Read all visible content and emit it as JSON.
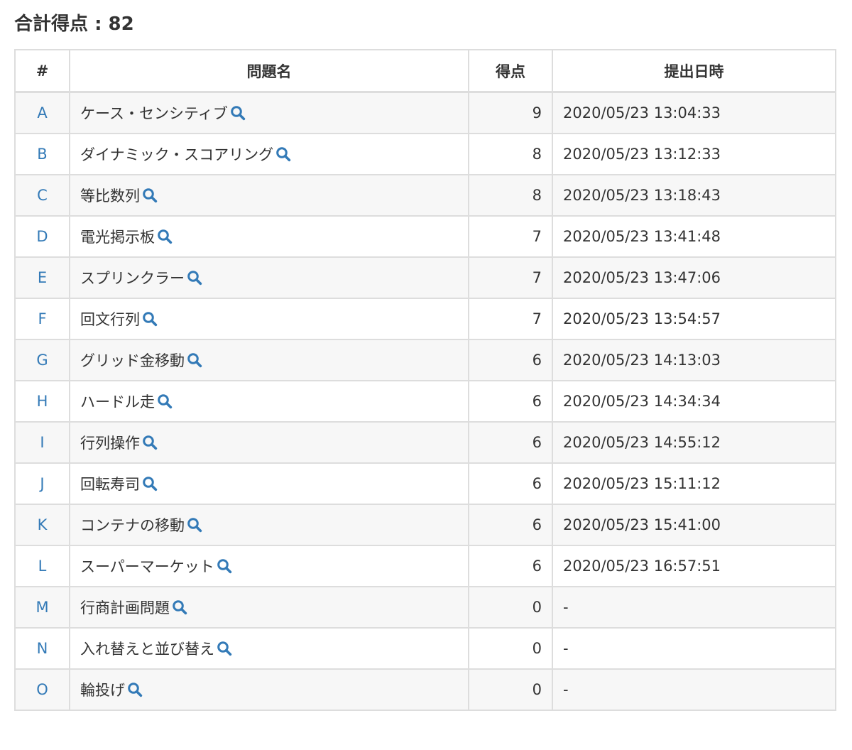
{
  "total": {
    "label": "合計得点",
    "separator": " : ",
    "value": "82"
  },
  "table": {
    "headers": [
      "#",
      "問題名",
      "得点",
      "提出日時"
    ],
    "rows": [
      {
        "id": "A",
        "name": "ケース・センシティブ",
        "score": "9",
        "submitted": "2020/05/23 13:04:33"
      },
      {
        "id": "B",
        "name": "ダイナミック・スコアリング",
        "score": "8",
        "submitted": "2020/05/23 13:12:33"
      },
      {
        "id": "C",
        "name": "等比数列",
        "score": "8",
        "submitted": "2020/05/23 13:18:43"
      },
      {
        "id": "D",
        "name": "電光掲示板",
        "score": "7",
        "submitted": "2020/05/23 13:41:48"
      },
      {
        "id": "E",
        "name": "スプリンクラー",
        "score": "7",
        "submitted": "2020/05/23 13:47:06"
      },
      {
        "id": "F",
        "name": "回文行列",
        "score": "7",
        "submitted": "2020/05/23 13:54:57"
      },
      {
        "id": "G",
        "name": "グリッド金移動",
        "score": "6",
        "submitted": "2020/05/23 14:13:03"
      },
      {
        "id": "H",
        "name": "ハードル走",
        "score": "6",
        "submitted": "2020/05/23 14:34:34"
      },
      {
        "id": "I",
        "name": "行列操作",
        "score": "6",
        "submitted": "2020/05/23 14:55:12"
      },
      {
        "id": "J",
        "name": "回転寿司",
        "score": "6",
        "submitted": "2020/05/23 15:11:12"
      },
      {
        "id": "K",
        "name": "コンテナの移動",
        "score": "6",
        "submitted": "2020/05/23 15:41:00"
      },
      {
        "id": "L",
        "name": "スーパーマーケット",
        "score": "6",
        "submitted": "2020/05/23 16:57:51"
      },
      {
        "id": "M",
        "name": "行商計画問題",
        "score": "0",
        "submitted": "-"
      },
      {
        "id": "N",
        "name": "入れ替えと並び替え",
        "score": "0",
        "submitted": "-"
      },
      {
        "id": "O",
        "name": "輪投げ",
        "score": "0",
        "submitted": "-"
      }
    ]
  },
  "icons": {
    "row_action": "search-icon"
  },
  "colors": {
    "link": "#337ab7",
    "text": "#333333",
    "border": "#dddddd",
    "stripe": "#f7f7f7"
  }
}
